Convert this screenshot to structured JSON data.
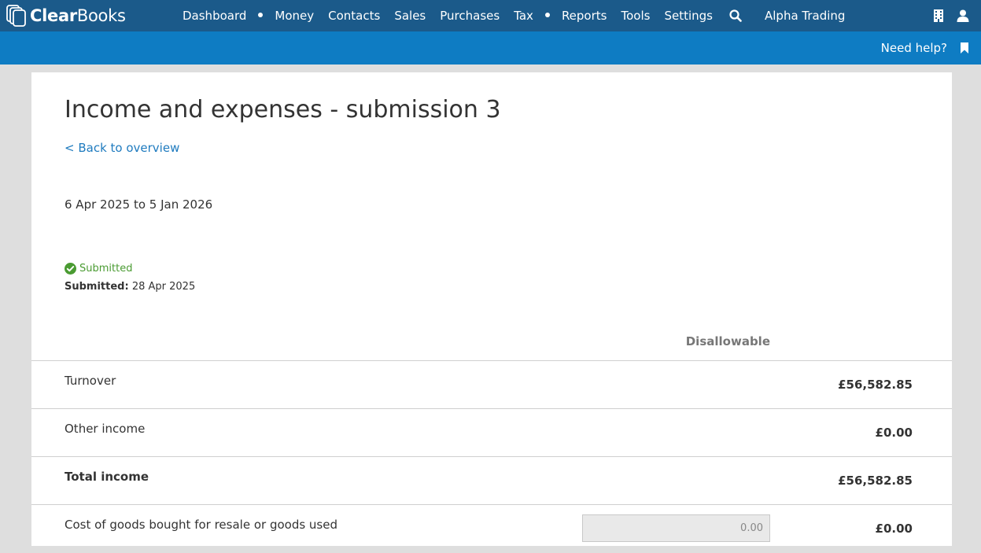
{
  "app": {
    "logo_text_bold": "Clear",
    "logo_text_regular": "Books"
  },
  "nav": {
    "items": [
      {
        "label": "Dashboard"
      },
      {
        "label": "Money"
      },
      {
        "label": "Contacts"
      },
      {
        "label": "Sales"
      },
      {
        "label": "Purchases"
      },
      {
        "label": "Tax"
      },
      {
        "label": "Reports"
      },
      {
        "label": "Tools"
      },
      {
        "label": "Settings"
      }
    ],
    "company": "Alpha Trading",
    "icons": [
      "search-icon",
      "building-icon",
      "user-icon"
    ]
  },
  "subbar": {
    "help_label": "Need help?",
    "icon": "bookmark-icon"
  },
  "page": {
    "title": "Income and expenses - submission 3",
    "back_link": "< Back to overview",
    "period": "6 Apr 2025 to 5 Jan 2026",
    "status": "Submitted",
    "submitted_label": "Submitted:",
    "submitted_date": "28 Apr 2025",
    "disallowable_header": "Disallowable"
  },
  "rows": [
    {
      "label": "Turnover",
      "value": "£56,582.85",
      "bold": false
    },
    {
      "label": "Other income",
      "value": "£0.00",
      "bold": false
    },
    {
      "label": "Total income",
      "value": "£56,582.85",
      "bold": true
    },
    {
      "label": "Cost of goods bought for resale or goods used",
      "value": "£0.00",
      "bold": false,
      "disallowable": "0.00"
    }
  ],
  "colors": {
    "topbar": "#1b5a8a",
    "subbar": "#0e7cc3",
    "link": "#1f7bbf",
    "success": "#4a9b32"
  }
}
